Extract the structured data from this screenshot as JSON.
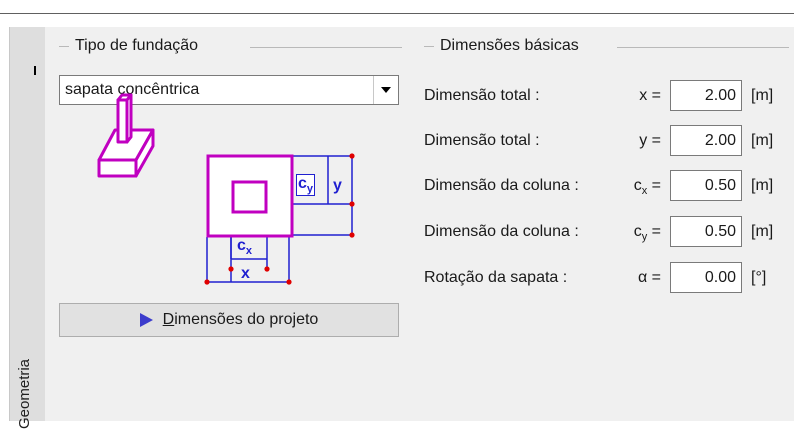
{
  "sidebar": {
    "tab_label": "Geometria"
  },
  "foundation_type": {
    "title": "Tipo de fundação",
    "selected": "sapata concêntrica",
    "diagram_labels": {
      "cy": "c",
      "cy_sub": "y",
      "y": "y",
      "cx": "c",
      "cx_sub": "x",
      "x": "x"
    }
  },
  "project_button": {
    "first_letter": "D",
    "rest": "imensões do projeto"
  },
  "basic_dimensions": {
    "title": "Dimensões básicas",
    "rows": [
      {
        "label": "Dimensão total :",
        "symbol": "x =",
        "value": "2.00",
        "unit": "[m]"
      },
      {
        "label": "Dimensão total :",
        "symbol": "y =",
        "value": "2.00",
        "unit": "[m]"
      },
      {
        "label": "Dimensão da coluna :",
        "symbol_main": "c",
        "symbol_sub": "x",
        "symbol_tail": " =",
        "value": "0.50",
        "unit": "[m]"
      },
      {
        "label": "Dimensão da coluna :",
        "symbol_main": "c",
        "symbol_sub": "y",
        "symbol_tail": " =",
        "value": "0.50",
        "unit": "[m]"
      },
      {
        "label": "Rotação da sapata :",
        "symbol": "α =",
        "value": "0.00",
        "unit": "[°]"
      }
    ]
  },
  "colors": {
    "footing_magenta": "#c000c0",
    "dimension_blue": "#2020d0",
    "point_red": "#e00000"
  }
}
